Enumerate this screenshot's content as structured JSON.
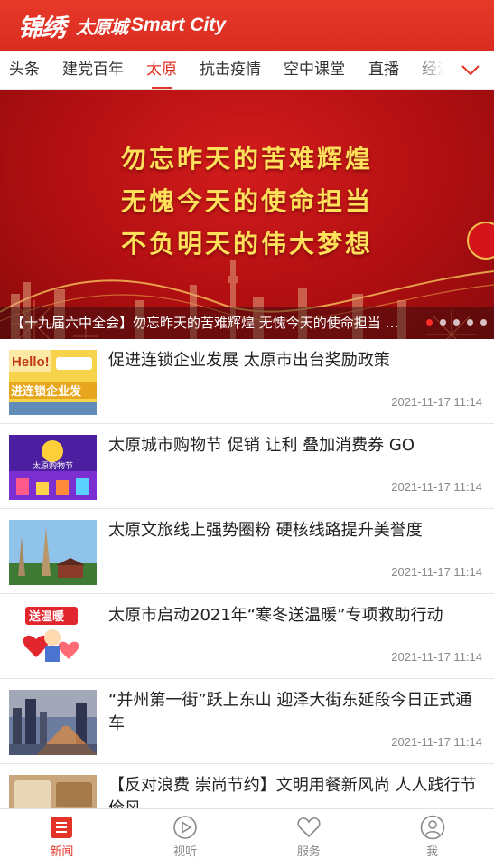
{
  "header": {
    "logo_script": "锦绣",
    "logo_cn": "太原城",
    "logo_en": "Smart City"
  },
  "tabs": [
    {
      "label": "头条",
      "active": false
    },
    {
      "label": "建党百年",
      "active": false
    },
    {
      "label": "太原",
      "active": true
    },
    {
      "label": "抗击疫情",
      "active": false
    },
    {
      "label": "空中课堂",
      "active": false
    },
    {
      "label": "直播",
      "active": false
    },
    {
      "label": "经济",
      "active": false
    }
  ],
  "tab_more_icon": "chevron-down-icon",
  "banner": {
    "lines": [
      "勿忘昨天的苦难辉煌",
      "无愧今天的使命担当",
      "不负明天的伟大梦想"
    ],
    "caption": "【十九届六中全会】勿忘昨天的苦难辉煌 无愧今天的使命担当 不负明天的伟大梦想",
    "slide_count": 5,
    "active_slide": 1
  },
  "news": [
    {
      "title": "促进连锁企业发展 太原市出台奖励政策",
      "time": "2021-11-17 11:14"
    },
    {
      "title": "太原城市购物节 促销 让利 叠加消费券 GO",
      "time": "2021-11-17 11:14"
    },
    {
      "title": "太原文旅线上强势圈粉 硬核线路提升美誉度",
      "time": "2021-11-17 11:14"
    },
    {
      "title": "太原市启动2021年“寒冬送温暖”专项救助行动",
      "time": "2021-11-17 11:14"
    },
    {
      "title": "“并州第一街”跃上东山 迎泽大街东延段今日正式通车",
      "time": "2021-11-17 11:14"
    },
    {
      "title": "【反对浪费 崇尚节约】文明用餐新风尚 人人践行节俭风",
      "time": ""
    }
  ],
  "thumb_text": {
    "hello": "Hello!",
    "chain": "进连锁企业发",
    "shopping": "太原购物节",
    "warmth": "送温暖"
  },
  "bottom_nav": [
    {
      "label": "新闻",
      "icon": "news-icon",
      "active": true
    },
    {
      "label": "视听",
      "icon": "play-icon",
      "active": false
    },
    {
      "label": "服务",
      "icon": "heart-icon",
      "active": false
    },
    {
      "label": "我",
      "icon": "user-icon",
      "active": false
    }
  ],
  "colors": {
    "brand_red": "#e23326",
    "banner_text": "#ffe05a"
  }
}
